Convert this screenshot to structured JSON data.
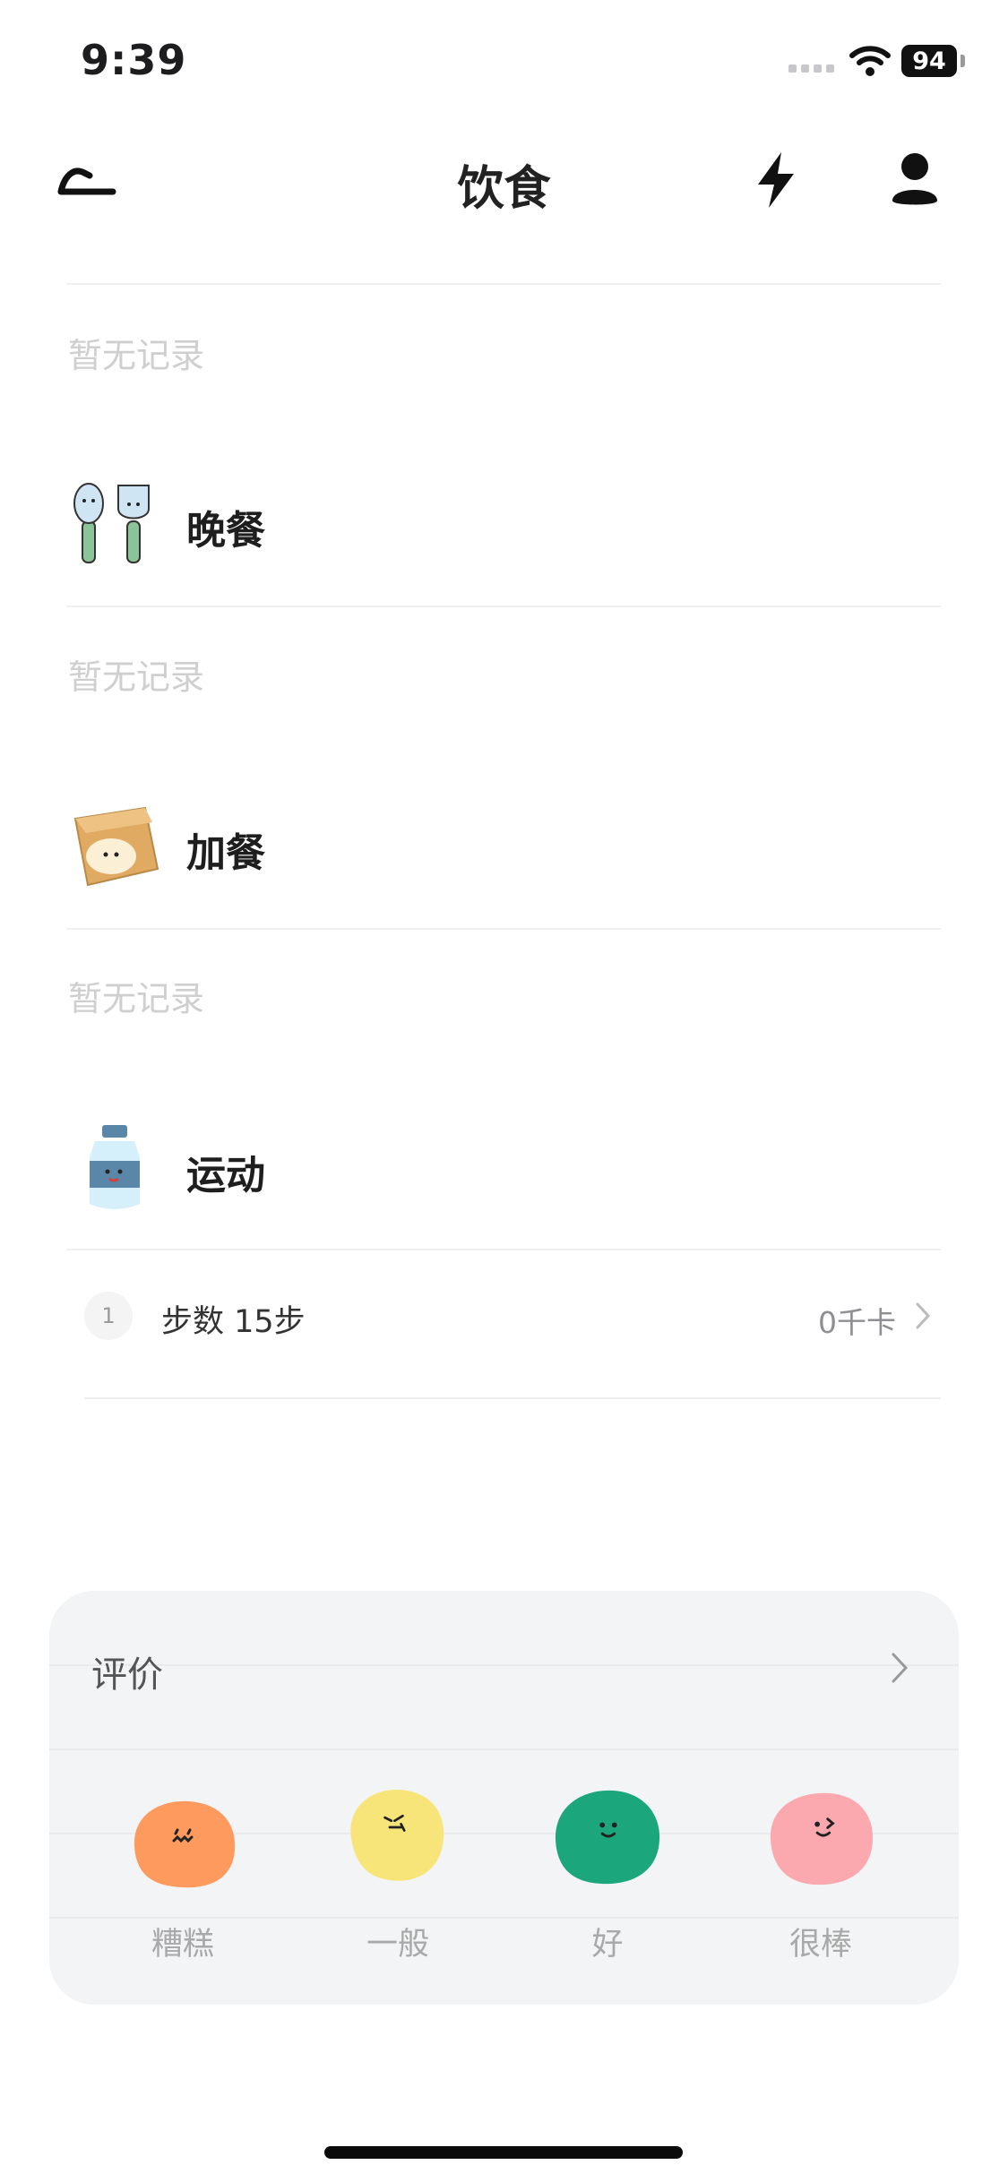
{
  "status_bar": {
    "time": "9:39",
    "battery": "94"
  },
  "nav": {
    "title": "饮食"
  },
  "sections": [
    {
      "empty_text": "暂无记录"
    },
    {
      "name": "晚餐",
      "icon": "utensils-icon",
      "empty_text": "暂无记录"
    },
    {
      "name": "加餐",
      "icon": "snack-bag-icon",
      "empty_text": "暂无记录"
    },
    {
      "name": "运动",
      "icon": "water-bottle-icon"
    }
  ],
  "exercise": {
    "index": "1",
    "name": "步数 15步",
    "calories": "0千卡"
  },
  "rating": {
    "title": "评价",
    "options": [
      {
        "label": "糟糕",
        "color": "#FF9A5E"
      },
      {
        "label": "一般",
        "color": "#F8E57A"
      },
      {
        "label": "好",
        "color": "#1BA67C"
      },
      {
        "label": "很棒",
        "color": "#FBA8AE"
      }
    ]
  }
}
